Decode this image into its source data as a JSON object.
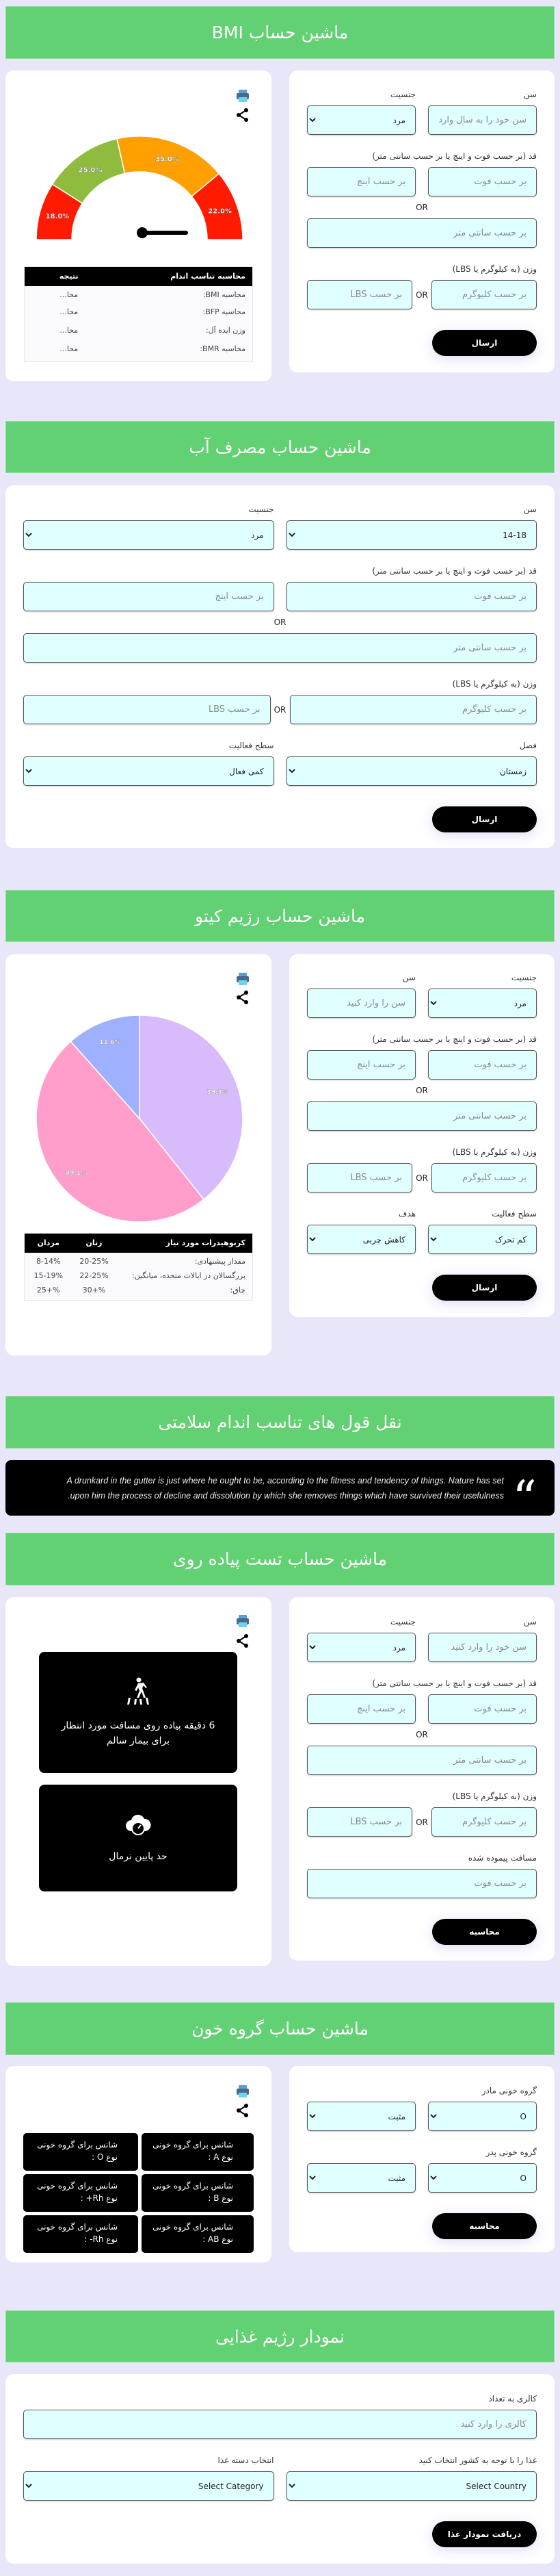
{
  "colors": {
    "accent": "#62d173",
    "background": "#e8e7f9",
    "input_bg": "#e0ffff",
    "button": "#000000"
  },
  "common": {
    "or": "OR",
    "inch_ph": "بر حسب اینچ",
    "foot_ph": "بر حسب فوت",
    "cm_ph": "بر حسب سانتی متر",
    "kg_ph": "بر حسب کلیوگرم",
    "lbs_ph": "بر حسب LBS",
    "height_label": "قد (بر حسب فوت و اینچ یا بر حسب سانتی متر)",
    "weight_label": "وزن (به کیلوگرم یا LBS)",
    "age_label": "سن",
    "gender_label": "جنسیت",
    "male": "مرد",
    "print_icon": "printer-icon",
    "share_icon": "share-icon"
  },
  "bmi": {
    "title": "ماشین حساب BMI",
    "age_ph": "سن خود را به سال وارد کنید",
    "submit": "ارسال",
    "table": {
      "headers": [
        "محاسبه تناسب اندام",
        "نتیجه"
      ],
      "rows": [
        [
          "محاسبه BMI:",
          "محا..."
        ],
        [
          "محاسبه BFP:",
          "محا..."
        ],
        [
          "وزن ایده آل:",
          "محا..."
        ],
        [
          "محاسبه BMR:",
          "محا..."
        ]
      ]
    }
  },
  "water": {
    "title": "ماشین حساب مصرف آب",
    "age_value": "14-18",
    "season_label": "فصل",
    "season_value": "زمستان",
    "activity_label": "سطح فعالیت",
    "activity_value": "کمی فعال",
    "submit": "ارسال"
  },
  "keto": {
    "title": "ماشین حساب رژیم کیتو",
    "age_ph": "سن را وارد کنید",
    "activity_label": "سطح فعالیت",
    "activity_value": "کم تحرک",
    "goal_label": "هدف",
    "goal_value": "کاهش چربی",
    "submit": "ارسال",
    "table": {
      "headers": [
        "کربوهیدرات مورد نیاز",
        "زنان",
        "مردان"
      ],
      "rows": [
        [
          "مقدار پیشنهادی:",
          "20-25%",
          "8-14%"
        ],
        [
          "بزرگسالان در ایالات متحده، میانگین:",
          "22-25%",
          "15-19%"
        ],
        [
          "چاق:",
          "%+30",
          "%+25"
        ]
      ]
    }
  },
  "quotes": {
    "title": "نقل قول های تناسب اندام سلامتی",
    "text": "A drunkard in the gutter is just where he ought to be, according to the fitness and tendency of things. Nature has set upon him the process of decline and dissolution by which she removes things which have survived their usefulness."
  },
  "walking": {
    "title": "ماشین حساب تست پیاده روی",
    "age_ph": "سن خود را وارد کنید",
    "distance_label": "مسافت پیموده شده",
    "distance_ph": "بر حسب فوت",
    "submit": "محاسبه",
    "result1": "6 دقیقه پیاده روی مسافت مورد انتظار برای بیمار سالم",
    "result2": "حد پایین نرمال",
    "icon1": "pedestrian-crossing-icon",
    "icon2": "cloud-speedometer-icon"
  },
  "blood": {
    "title": "ماشین حساب گروه خون",
    "mother_label": "گروه خونی مادر",
    "father_label": "گروه خونی پدر",
    "type_value": "O",
    "rh_value": "مثبت",
    "submit": "محاسبه",
    "chances": [
      "شانس برای گروه خونی نوع A :",
      "شانس برای گروه خونی نوع O :",
      "شانس برای گروه خونی نوع B :",
      "شانس برای گروه خونی نوع Rh+ :",
      "شانس برای گروه خونی نوع AB :",
      "شانس برای گروه خونی نوع Rh- :"
    ]
  },
  "diet": {
    "title": "نمودار رژیم غذایی",
    "calorie_label": "کالری به تعداد",
    "calorie_ph": "کالری را وارد کنید",
    "country_label": "غذا را با توجه به کشور انتخاب کنید",
    "country_value": "Select Country",
    "category_label": "انتخاب دسته غذا",
    "category_value": "Select Category",
    "submit": "دریافت نمودار غذا"
  },
  "chart_data": [
    {
      "type": "gauge",
      "labels": [
        "18.0%",
        "25.0%",
        "35.0%",
        "22.0%"
      ],
      "values": [
        18,
        25,
        35,
        22
      ],
      "colors": [
        "#ff1a00",
        "#8fbc3f",
        "#ffa000",
        "#ff1a00"
      ],
      "needle_direction": "right"
    },
    {
      "type": "pie",
      "labels": [
        "39.3%",
        "49.1%",
        "11.6%"
      ],
      "values": [
        39.3,
        49.1,
        11.6
      ],
      "colors": [
        "#d8bbfb",
        "#ff9ecb",
        "#9fb0ff"
      ]
    }
  ]
}
